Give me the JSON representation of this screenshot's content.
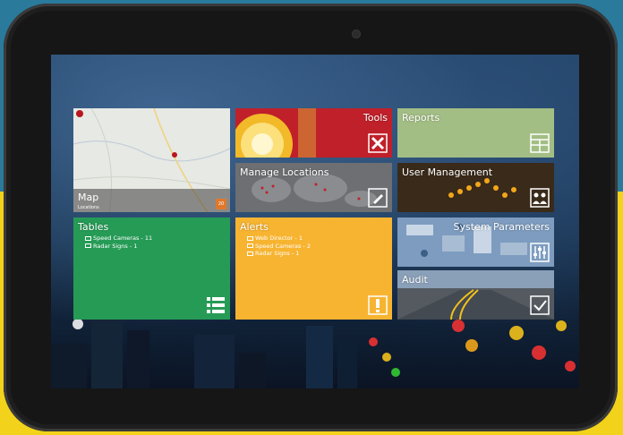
{
  "tiles": {
    "map": {
      "title": "Map",
      "subtitle": "Locations",
      "badge": "20"
    },
    "tools": {
      "title": "Tools"
    },
    "reports": {
      "title": "Reports"
    },
    "manage_locations": {
      "title": "Manage Locations"
    },
    "user_management": {
      "title": "User Management"
    },
    "tables": {
      "title": "Tables",
      "items": [
        "Speed Cameras - 11",
        "Radar Signs - 1"
      ]
    },
    "alerts": {
      "title": "Alerts",
      "items": [
        "Web Director - 1",
        "Speed Cameras - 2",
        "Radar Signs - 1"
      ]
    },
    "system_parameters": {
      "title": "System Parameters"
    },
    "audit": {
      "title": "Audit"
    }
  },
  "colors": {
    "tools": "#c0202a",
    "reports": "#a3be84",
    "tables": "#269b56",
    "alerts": "#f7b431",
    "screen_bg": "#1e3f63"
  },
  "icons": [
    "map-pin-icon",
    "tools-icon",
    "report-icon",
    "edit-icon",
    "users-icon",
    "list-icon",
    "alert-icon",
    "sliders-icon",
    "check-icon"
  ]
}
